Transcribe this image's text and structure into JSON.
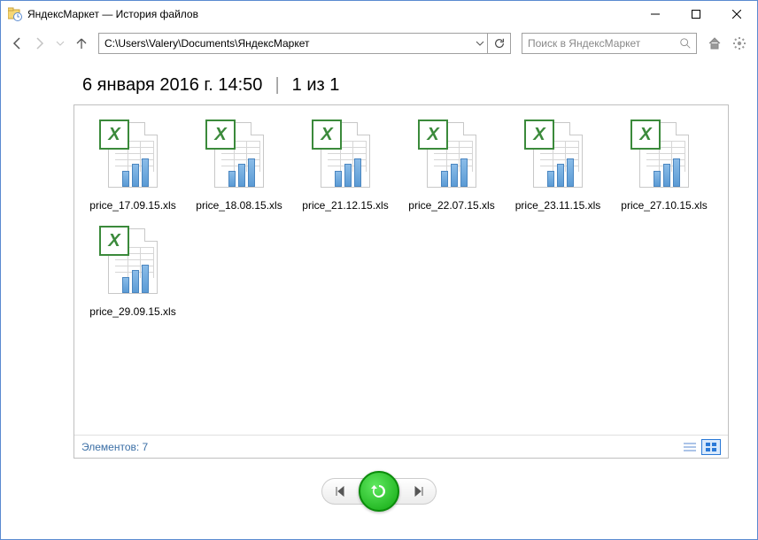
{
  "window": {
    "title": "ЯндексМаркет — История файлов"
  },
  "nav": {
    "path": "C:\\Users\\Valery\\Documents\\ЯндексМаркет",
    "search_placeholder": "Поиск в ЯндексМаркет"
  },
  "heading": {
    "timestamp": "6 января 2016 г. 14:50",
    "counter": "1 из 1"
  },
  "files": [
    {
      "name": "price_17.09.15.xls"
    },
    {
      "name": "price_18.08.15.xls"
    },
    {
      "name": "price_21.12.15.xls"
    },
    {
      "name": "price_22.07.15.xls"
    },
    {
      "name": "price_23.11.15.xls"
    },
    {
      "name": "price_27.10.15.xls"
    },
    {
      "name": "price_29.09.15.xls"
    }
  ],
  "footer": {
    "count_label": "Элементов: 7"
  }
}
